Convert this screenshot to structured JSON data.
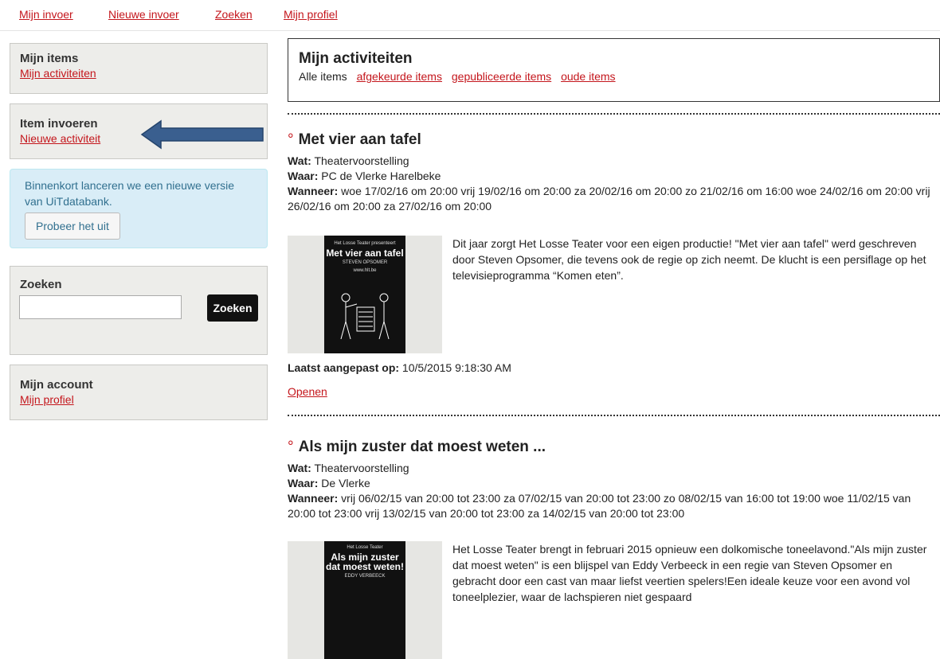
{
  "topnav": {
    "items": [
      "Mijn invoer",
      "Nieuwe invoer",
      "Zoeken",
      "Mijn profiel"
    ]
  },
  "sidebar": {
    "my_items": {
      "title": "Mijn items",
      "link": "Mijn activiteiten"
    },
    "add_item": {
      "title": "Item invoeren",
      "link": "Nieuwe activiteit"
    },
    "notice": {
      "text": "Binnenkort lanceren we een nieuwe versie van UiTdatabank.",
      "button": "Probeer het uit"
    },
    "search": {
      "title": "Zoeken",
      "placeholder": "",
      "button": "Zoeken"
    },
    "account": {
      "title": "Mijn account",
      "link": "Mijn profiel"
    }
  },
  "main": {
    "title": "Mijn activiteiten",
    "filters": {
      "current": "Alle items",
      "links": [
        "afgekeurde items",
        "gepubliceerde items",
        "oude items"
      ]
    },
    "labels": {
      "what": "Wat:",
      "where": "Waar:",
      "when": "Wanneer:",
      "modified": "Laatst aangepast op:",
      "open": "Openen"
    },
    "items": [
      {
        "marker": "°",
        "title": "Met vier aan tafel",
        "what": "Theatervoorstelling",
        "where": "PC de Vlerke Harelbeke",
        "when": "woe 17/02/16 om 20:00 vrij 19/02/16 om 20:00 za 20/02/16 om 20:00 zo 21/02/16 om 16:00 woe 24/02/16 om 20:00 vrij 26/02/16 om 20:00 za 27/02/16 om 20:00",
        "description": "Dit jaar zorgt Het Losse Teater voor een eigen productie! \"Met vier aan tafel\" werd geschreven door Steven Opsomer, die tevens ook de regie op zich neemt. De klucht is een persiflage op het televisieprogramma “Komen eten”.",
        "modified": "10/5/2015 9:18:30 AM",
        "poster_title": "Met vier aan tafel",
        "poster_sub": "STEVEN OPSOMER",
        "poster_url": "www.hlt.be"
      },
      {
        "marker": "°",
        "title": "Als mijn zuster dat moest weten ...",
        "what": "Theatervoorstelling",
        "where": "De Vlerke",
        "when": "vrij 06/02/15 van 20:00 tot 23:00 za 07/02/15 van 20:00 tot 23:00 zo 08/02/15 van 16:00 tot 19:00 woe 11/02/15 van 20:00 tot 23:00 vrij 13/02/15 van 20:00 tot 23:00 za 14/02/15 van 20:00 tot 23:00",
        "description": "Het Losse Teater brengt in februari 2015 opnieuw een dolkomische toneelavond.\"Als mijn zuster dat moest weten\" is een blijspel van Eddy Verbeeck in een regie van Steven Opsomer en gebracht door een cast van maar liefst veertien spelers!Een ideale keuze voor een avond vol toneelplezier, waar de lachspieren niet gespaard",
        "poster_title": "Als mijn zuster dat moest weten!",
        "poster_sub": "EDDY VERBEECK"
      }
    ]
  },
  "colors": {
    "link": "#c4161c",
    "arrow": "#3a5f8f",
    "notice_bg": "#d9edf7"
  }
}
